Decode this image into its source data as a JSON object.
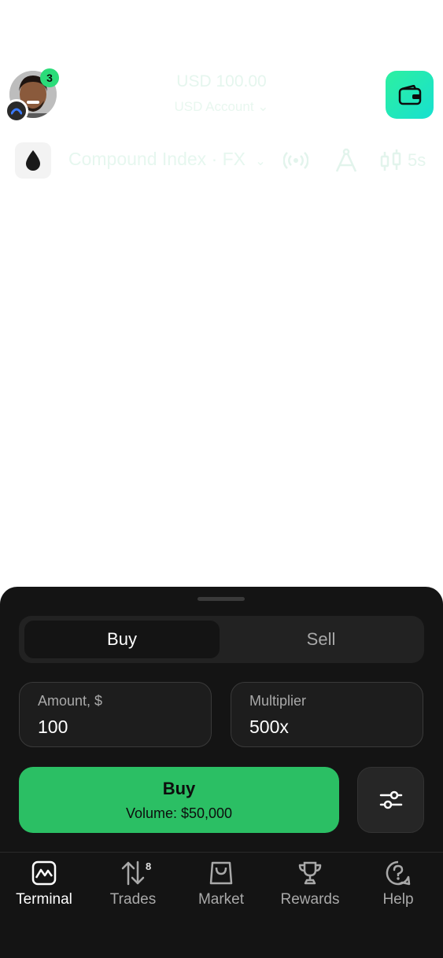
{
  "header": {
    "notification_count": "3",
    "balance": "USD 100.00",
    "account_label": "USD Account",
    "account_chevron": "⌄"
  },
  "instrument": {
    "name": "Compound Index · FX",
    "chevron": "⌄",
    "timeframe": "5s"
  },
  "trade_panel": {
    "tabs": [
      {
        "label": "Buy",
        "active": true
      },
      {
        "label": "Sell",
        "active": false
      }
    ],
    "amount": {
      "label": "Amount, $",
      "value": "100"
    },
    "multiplier": {
      "label": "Multiplier",
      "value": "500x"
    },
    "buy_button": {
      "title": "Buy",
      "volume": "Volume: $50,000"
    }
  },
  "nav": {
    "items": [
      {
        "label": "Terminal",
        "icon": "terminal-icon",
        "active": true
      },
      {
        "label": "Trades",
        "icon": "trades-icon",
        "badge": "8"
      },
      {
        "label": "Market",
        "icon": "market-icon"
      },
      {
        "label": "Rewards",
        "icon": "rewards-icon"
      },
      {
        "label": "Help",
        "icon": "help-icon"
      }
    ]
  },
  "colors": {
    "accent_green": "#2bbf64",
    "badge_green": "#2bdc79",
    "wallet_gradient_start": "#2df0a0",
    "wallet_gradient_end": "#17e0d0",
    "sheet_bg": "#141414"
  }
}
